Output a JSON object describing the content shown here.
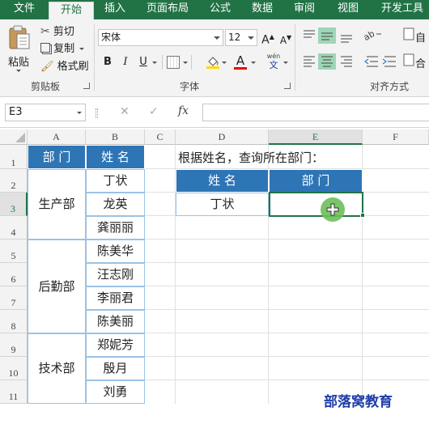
{
  "ribbon": {
    "tabs": [
      "文件",
      "开始",
      "插入",
      "页面布局",
      "公式",
      "数据",
      "审阅",
      "视图",
      "开发工具"
    ],
    "active_tab": "开始",
    "clipboard": {
      "paste_label": "粘贴",
      "cut_label": "剪切",
      "copy_label": "复制",
      "format_painter_label": "格式刷",
      "group_label": "剪贴板"
    },
    "font": {
      "font_name": "宋体",
      "font_size": "12",
      "grow_label": "A",
      "shrink_label": "A",
      "bold": "B",
      "italic": "I",
      "underline": "U",
      "font_color_label": "A",
      "phonetic_top": "wén",
      "phonetic_bottom": "文",
      "group_label": "字体"
    },
    "alignment": {
      "group_label": "对齐方式",
      "wrap_label": "自",
      "merge_label": "合"
    }
  },
  "formula_bar": {
    "name_box": "E3",
    "cancel_icon": "✕",
    "enter_icon": "✓",
    "fx_label": "fx",
    "value": ""
  },
  "sheet": {
    "columns": [
      "A",
      "B",
      "C",
      "D",
      "E",
      "F"
    ],
    "selected_column": "E",
    "rows": [
      "1",
      "2",
      "3",
      "4",
      "5",
      "6",
      "7",
      "8",
      "9",
      "10",
      "11"
    ],
    "selected_row": "3",
    "left_table": {
      "header_dept": "部 门",
      "header_name": "姓 名",
      "groups": [
        {
          "dept": "生产部",
          "names": [
            "丁状",
            "龙英",
            "龚丽丽"
          ]
        },
        {
          "dept": "后勤部",
          "names": [
            "陈美华",
            "汪志刚",
            "李丽君",
            "陈美丽"
          ]
        },
        {
          "dept": "技术部",
          "names": [
            "郑妮芳",
            "殷月",
            "刘勇"
          ]
        }
      ]
    },
    "lookup": {
      "prompt": "根据姓名，查询所在部门：",
      "header_name": "姓 名",
      "header_dept": "部 门",
      "name_value": "丁状",
      "dept_value": ""
    },
    "watermark": "部落窝教育"
  },
  "colors": {
    "excel_green": "#217346",
    "table_header_blue": "#2e75b6",
    "cursor_green": "#6bbf59"
  }
}
